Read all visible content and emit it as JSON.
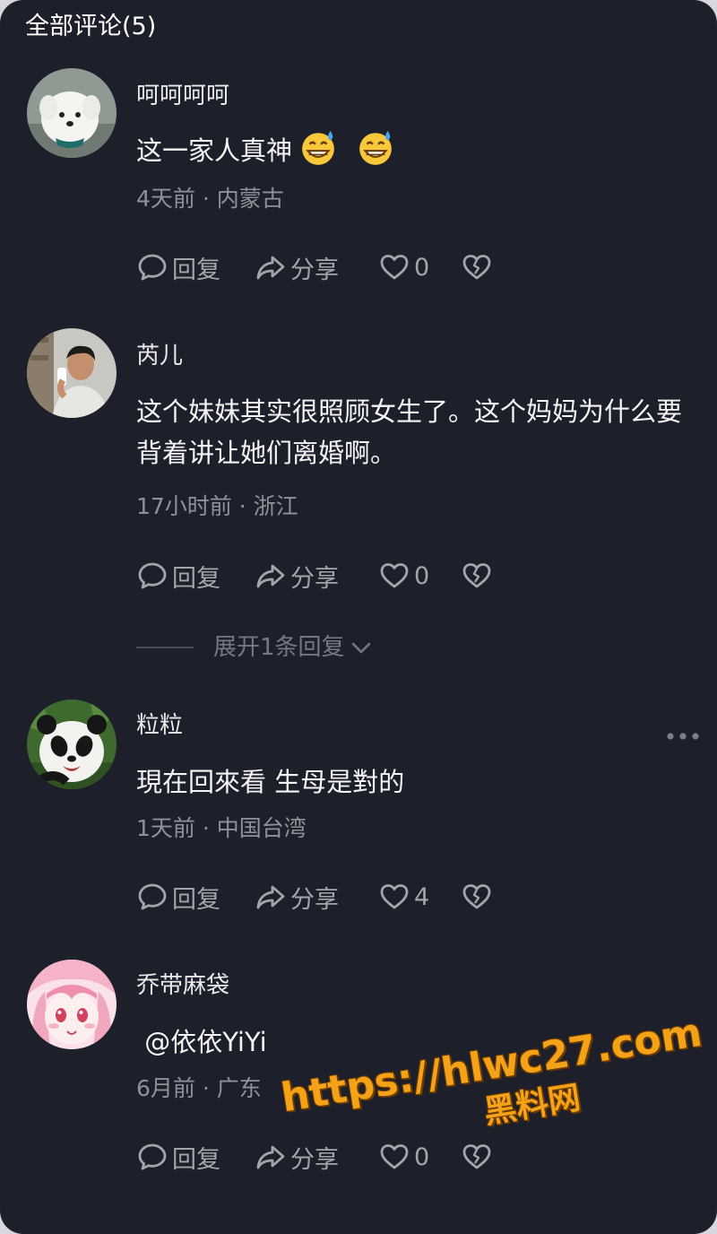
{
  "header": {
    "title": "全部评论(5)"
  },
  "actions": {
    "reply": "回复",
    "share": "分享"
  },
  "comments": [
    {
      "username": "呵呵呵呵",
      "text": "这一家人真神",
      "emojis": [
        "grinning-sweat-emoji",
        "grinning-sweat-emoji"
      ],
      "time": "4天前",
      "location": "内蒙古",
      "likes": "0"
    },
    {
      "username": "芮儿",
      "text": "这个妹妹其实很照顾女生了。这个妈妈为什么要背着讲让她们离婚啊。",
      "time": "17小时前",
      "location": "浙江",
      "likes": "0"
    },
    {
      "username": "粒粒",
      "text": "現在回來看 生母是對的",
      "time": "1天前",
      "location": "中国台湾",
      "likes": "4"
    },
    {
      "username": "乔带麻袋",
      "text": " @依依YiYi",
      "time": "6月前",
      "location": "广东",
      "likes": "0"
    }
  ],
  "expand": {
    "label": "展开1条回复"
  },
  "watermark": {
    "url": "https://hlwc27.com",
    "name": "黑料网"
  },
  "colors": {
    "background": "#1d1f2a",
    "text": "#f4f5f7",
    "muted": "#8f919a",
    "watermark": "#f4a318"
  }
}
